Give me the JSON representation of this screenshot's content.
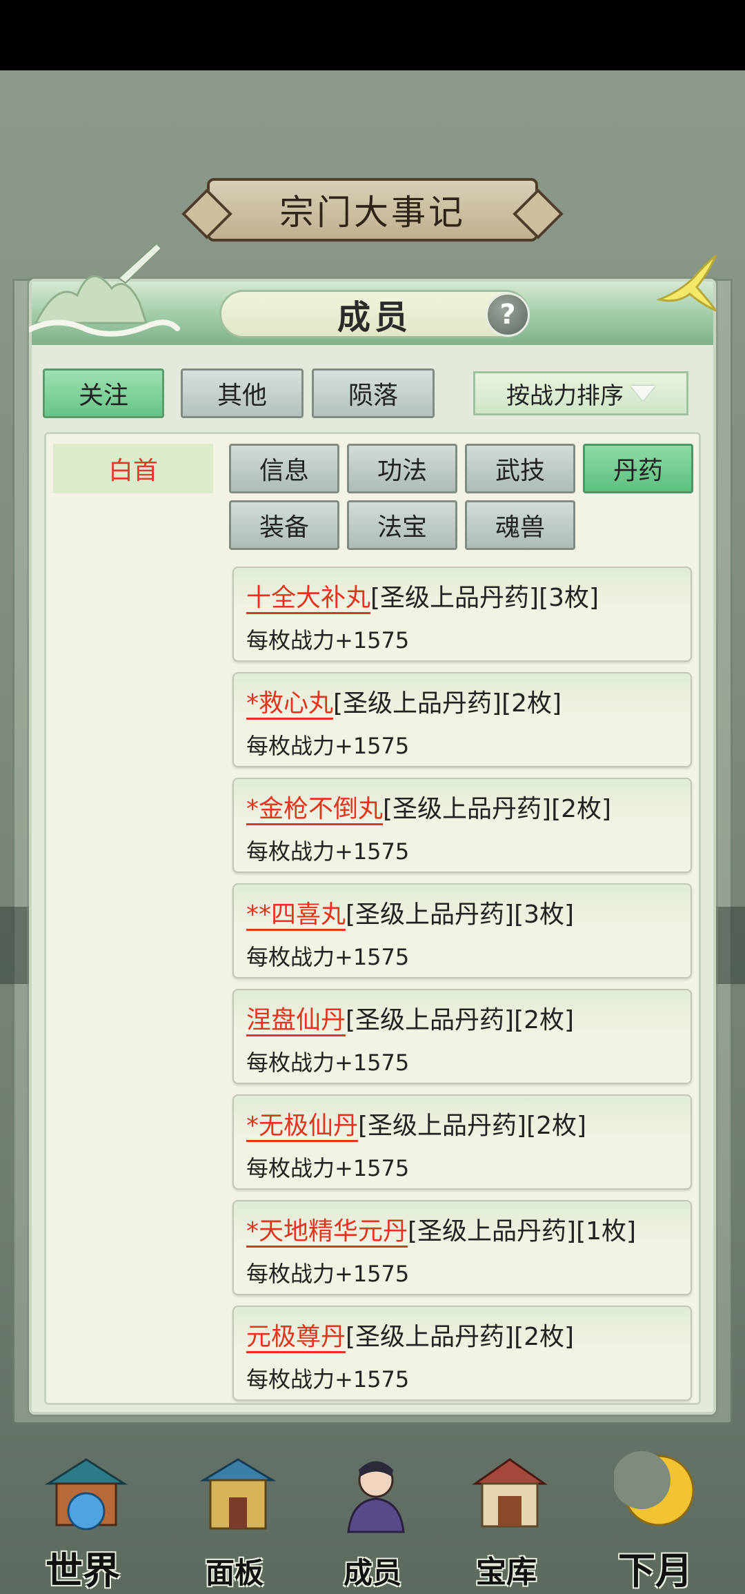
{
  "background": {
    "event_title": "宗门大事记"
  },
  "modal": {
    "title": "成员",
    "help_symbol": "?"
  },
  "filters": [
    {
      "label": "关注",
      "active": true
    },
    {
      "label": "其他",
      "active": false
    },
    {
      "label": "陨落",
      "active": false
    }
  ],
  "sort": {
    "label": "按战力排序"
  },
  "member": {
    "name": "白首"
  },
  "categories": [
    {
      "label": "信息",
      "active": false
    },
    {
      "label": "功法",
      "active": false
    },
    {
      "label": "武技",
      "active": false
    },
    {
      "label": "丹药",
      "active": true
    },
    {
      "label": "装备",
      "active": false
    },
    {
      "label": "法宝",
      "active": false
    },
    {
      "label": "魂兽",
      "active": false
    }
  ],
  "pills": [
    {
      "name": "十全大补丸",
      "grade": "[圣级上品丹药]",
      "count": "[3枚]",
      "power": "每枚战力+1575"
    },
    {
      "name": "*救心丸",
      "grade": "[圣级上品丹药]",
      "count": "[2枚]",
      "power": "每枚战力+1575"
    },
    {
      "name": "*金枪不倒丸",
      "grade": "[圣级上品丹药]",
      "count": "[2枚]",
      "power": "每枚战力+1575"
    },
    {
      "name": "**四喜丸",
      "grade": "[圣级上品丹药]",
      "count": "[3枚]",
      "power": "每枚战力+1575"
    },
    {
      "name": "涅盘仙丹",
      "grade": "[圣级上品丹药]",
      "count": "[2枚]",
      "power": "每枚战力+1575"
    },
    {
      "name": "*无极仙丹",
      "grade": "[圣级上品丹药]",
      "count": "[2枚]",
      "power": "每枚战力+1575"
    },
    {
      "name": "*天地精华元丹",
      "grade": "[圣级上品丹药]",
      "count": "[1枚]",
      "power": "每枚战力+1575"
    },
    {
      "name": "元极尊丹",
      "grade": "[圣级上品丹药]",
      "count": "[2枚]",
      "power": "每枚战力+1575"
    }
  ],
  "nav": [
    {
      "label": "世界",
      "icon": "world-icon"
    },
    {
      "label": "面板",
      "icon": "panel-icon"
    },
    {
      "label": "成员",
      "icon": "member-icon"
    },
    {
      "label": "宝库",
      "icon": "treasury-icon"
    },
    {
      "label": "下月",
      "icon": "next-month-icon"
    }
  ],
  "colors": {
    "accent_green": "#67c487",
    "pill_name_red": "#e0361f",
    "member_name_red": "#e03a2a"
  }
}
